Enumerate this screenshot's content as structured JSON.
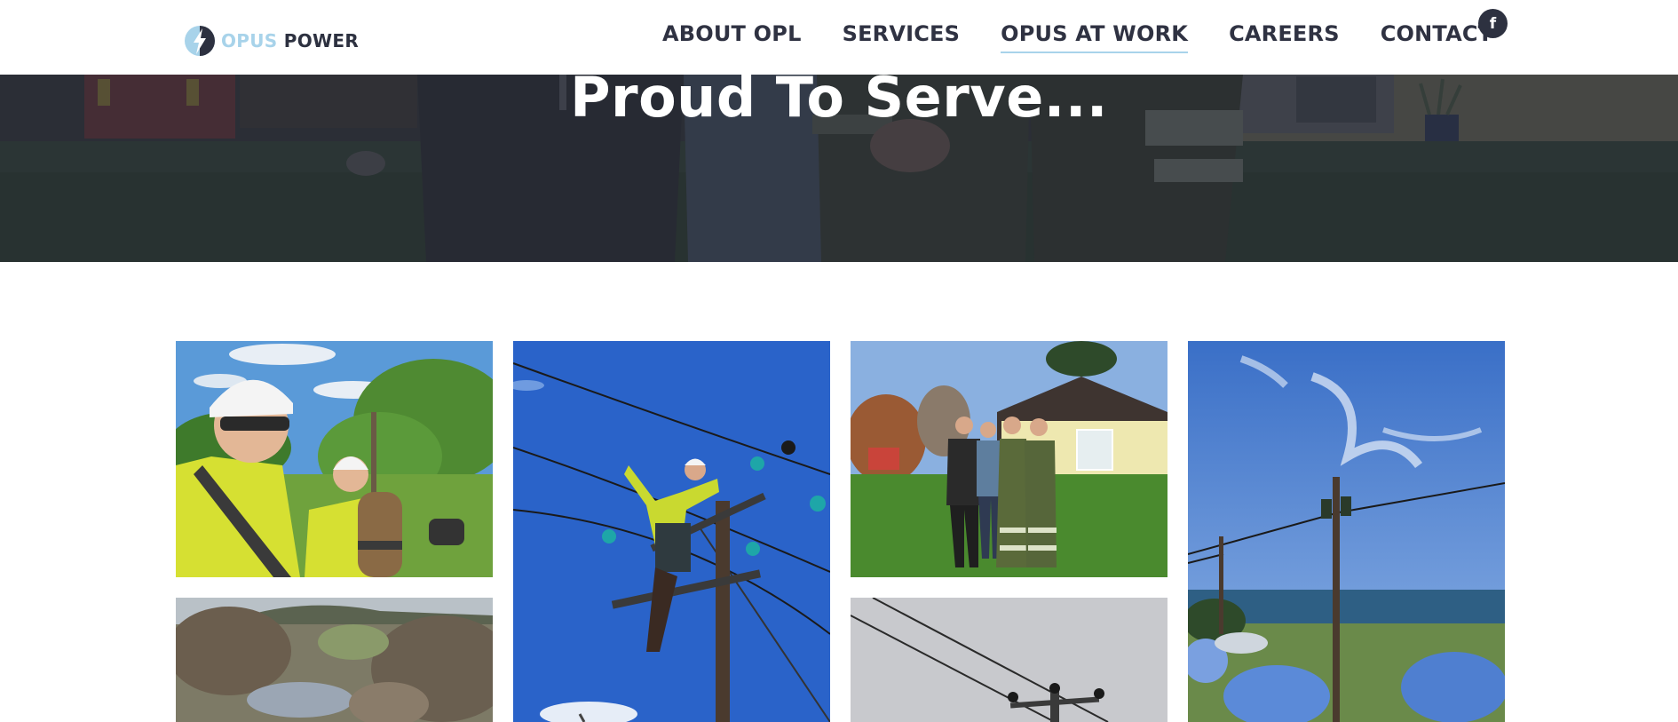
{
  "header": {
    "logo": {
      "word1": "OPUS",
      "word2": "POWER",
      "icon": "lightning-bolt-icon"
    },
    "nav": [
      {
        "label": "ABOUT OPL",
        "active": false
      },
      {
        "label": "SERVICES",
        "active": false
      },
      {
        "label": "OPUS AT WORK",
        "active": true
      },
      {
        "label": "CAREERS",
        "active": false
      },
      {
        "label": "CONTACT",
        "active": false
      }
    ],
    "social": {
      "facebook_glyph": "f",
      "icon": "facebook-icon"
    }
  },
  "hero": {
    "title": "Proud To Serve..."
  },
  "colors": {
    "brand_dark": "#2d3140",
    "brand_light": "#a8d3ea",
    "nav_text": "#2f3242",
    "hero_overlay": "#2c3040"
  }
}
